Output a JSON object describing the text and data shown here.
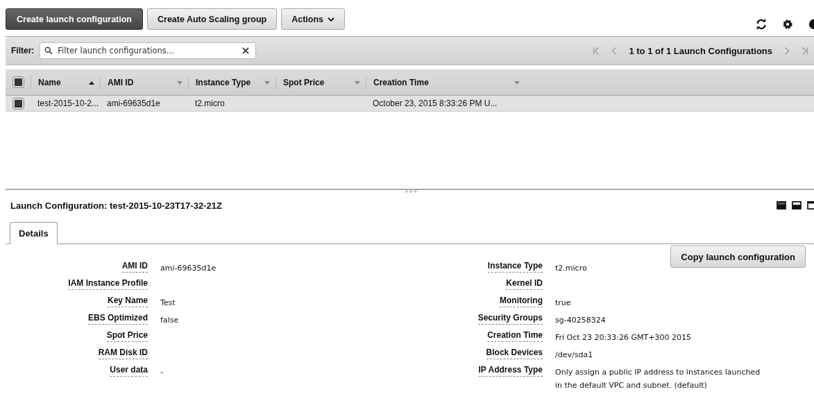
{
  "toolbar": {
    "buttons": [
      {
        "label": "Create launch configuration",
        "kind": "primary"
      },
      {
        "label": "Create Auto Scaling group",
        "kind": "normal"
      },
      {
        "label": "Actions",
        "kind": "dropdown"
      }
    ]
  },
  "filter": {
    "label": "Filter:",
    "placeholder": "Filter launch configurations...",
    "pagination": "1 to 1 of 1 Launch Configurations"
  },
  "table": {
    "columns": [
      {
        "label": "Name",
        "sorted": true
      },
      {
        "label": "AMI ID",
        "sorted": false
      },
      {
        "label": "Instance Type",
        "sorted": false
      },
      {
        "label": "Spot Price",
        "sorted": false
      },
      {
        "label": "Creation Time",
        "sorted": false
      }
    ],
    "all_checked": true,
    "rows": [
      {
        "selected": true,
        "cells": [
          "test-2015-10-2...",
          "ami-69635d1e",
          "t2.micro",
          null,
          "October 23, 2015 8:33:26 PM U..."
        ]
      }
    ]
  },
  "detail": {
    "title": "Launch Configuration: test-2015-10-23T17-32-21Z",
    "tabs": [
      {
        "label": "Details",
        "selected": true
      }
    ],
    "copy_button": "Copy launch configuration",
    "left": [
      {
        "label": "AMI ID",
        "value": "ami-69635d1e"
      },
      {
        "label": "IAM Instance Profile"
      },
      {
        "label": "Key Name",
        "value": "Test"
      },
      {
        "label": "EBS Optimized",
        "value": "false"
      },
      {
        "label": "Spot Price"
      },
      {
        "label": "RAM Disk ID"
      },
      {
        "label": "User data",
        "value": "-"
      }
    ],
    "right": [
      {
        "label": "Instance Type",
        "value": "t2.micro"
      },
      {
        "label": "Kernel ID"
      },
      {
        "label": "Monitoring",
        "value": "true"
      },
      {
        "label": "Security Groups",
        "value": "sg-40258324"
      },
      {
        "label": "Creation Time",
        "value": "Fri Oct 23 20:33:26 GMT+300 2015"
      },
      {
        "label": "Block Devices",
        "value": "/dev/sda1"
      },
      {
        "label": "IP Address Type",
        "value": "Only assign a public IP address to instances launched in the default VPC and subnet. (default)"
      }
    ]
  }
}
